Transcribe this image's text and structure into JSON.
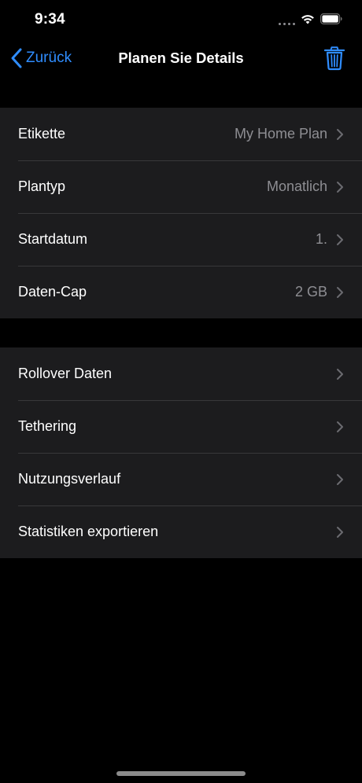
{
  "status_bar": {
    "time": "9:34"
  },
  "nav": {
    "back_label": "Zurück",
    "title": "Planen Sie Details"
  },
  "groups": [
    {
      "rows": [
        {
          "label": "Etikette",
          "value": "My Home Plan"
        },
        {
          "label": "Plantyp",
          "value": "Monatlich"
        },
        {
          "label": "Startdatum",
          "value": "1."
        },
        {
          "label": "Daten-Cap",
          "value": "2 GB"
        }
      ]
    },
    {
      "rows": [
        {
          "label": "Rollover Daten"
        },
        {
          "label": "Tethering"
        },
        {
          "label": "Nutzungsverlauf"
        },
        {
          "label": "Statistiken exportieren"
        }
      ]
    }
  ],
  "colors": {
    "accent": "#2f8dff",
    "background": "#000000",
    "group_background": "#1c1c1e",
    "secondary_text": "#8e8e93",
    "separator": "#38383a"
  },
  "icons": {
    "back": "chevron-left-icon",
    "trash": "trash-icon",
    "row_disclosure": "chevron-right-icon",
    "wifi": "wifi-icon",
    "battery": "battery-icon",
    "signal": "signal-icon"
  }
}
